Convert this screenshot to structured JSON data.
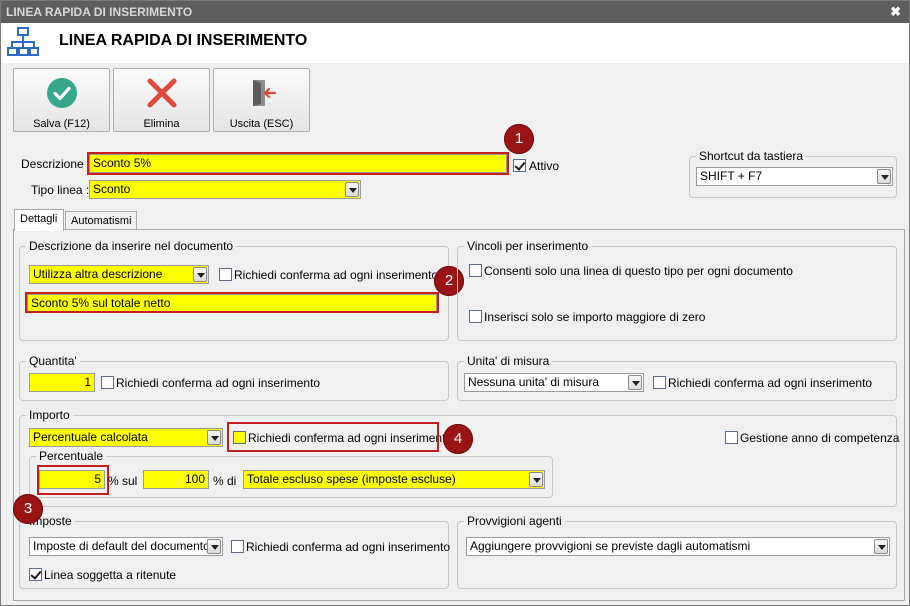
{
  "window": {
    "titlebar": "LINEA RAPIDA DI INSERIMENTO",
    "header_title": "LINEA RAPIDA DI INSERIMENTO"
  },
  "toolbar": {
    "save_label": "Salva (F12)",
    "delete_label": "Elimina",
    "exit_label": "Uscita (ESC)"
  },
  "form": {
    "descrizione_label": "Descrizione :",
    "descrizione_value": "Sconto 5%",
    "attivo_label": "Attivo",
    "tipo_linea_label": "Tipo linea :",
    "tipo_linea_value": "Sconto"
  },
  "shortcut": {
    "group_title": "Shortcut da tastiera",
    "value": "SHIFT + F7"
  },
  "tabs": [
    "Dettagli",
    "Automatismi"
  ],
  "descrizione_doc": {
    "group_title": "Descrizione da inserire nel documento",
    "mode_value": "Utilizza altra descrizione",
    "confirm_label": "Richiedi conferma ad ogni inserimento",
    "text_value": "Sconto 5% sul totale netto"
  },
  "vincoli": {
    "group_title": "Vincoli per inserimento",
    "option1": "Consenti solo una linea di questo tipo per ogni documento",
    "option2": "Inserisci solo se importo maggiore di zero"
  },
  "quantita": {
    "group_title": "Quantita'",
    "value": "1",
    "confirm_label": "Richiedi conferma ad ogni inserimento"
  },
  "unita": {
    "group_title": "Unita' di misura",
    "value": "Nessuna unita' di misura",
    "confirm_label": "Richiedi conferma ad ogni inserimento"
  },
  "importo": {
    "group_title": "Importo",
    "mode_value": "Percentuale calcolata",
    "confirm_label": "Richiedi conferma ad ogni inserimento",
    "gestione_label": "Gestione anno di competenza",
    "percentuale": {
      "group_title": "Percentuale",
      "value": "5",
      "sul_label": "% sul",
      "base_value": "100",
      "di_label": "% di",
      "target_value": "Totale escluso spese (imposte escluse)"
    }
  },
  "imposte": {
    "group_title": "Imposte",
    "value": "Imposte di default del documento",
    "confirm_label": "Richiedi conferma ad ogni inserimento",
    "ritenute_label": "Linea soggetta a ritenute"
  },
  "provvigioni": {
    "group_title": "Provvigioni agenti",
    "value": "Aggiungere provvigioni se previste dagli automatismi"
  },
  "badges": [
    "1",
    "2",
    "3",
    "4"
  ],
  "colors": {
    "highlight_yellow": "#ffff00",
    "annotation_red": "#c41e1e",
    "badge_fill": "#9a1414"
  }
}
